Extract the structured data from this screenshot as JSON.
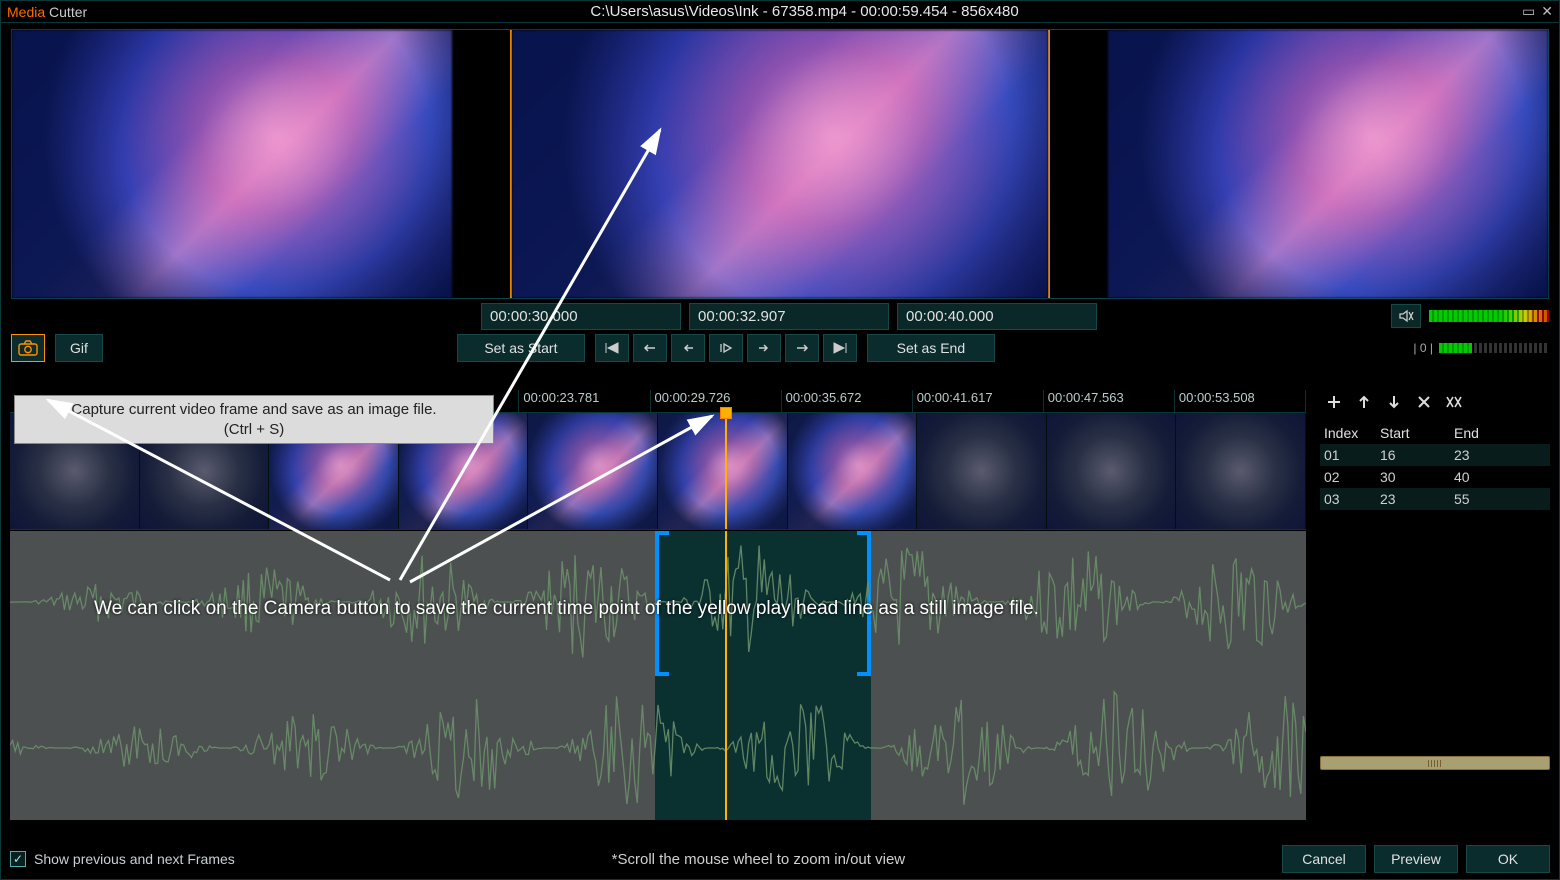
{
  "app": {
    "title_media": "Media",
    "title_cutter": " Cutter"
  },
  "file": {
    "path": "C:\\Users\\asus\\Videos\\Ink - 67358.mp4 - 00:00:59.454 - 856x480"
  },
  "times": {
    "start": "00:00:30.000",
    "current": "00:00:32.907",
    "end": "00:00:40.000"
  },
  "buttons": {
    "gif": "Gif",
    "set_start": "Set as Start",
    "set_end": "Set as End",
    "cancel": "Cancel",
    "preview": "Preview",
    "ok": "OK"
  },
  "tooltip": {
    "line1": "Capture current video frame and save as an image file.",
    "line2": "(Ctrl + S)"
  },
  "ruler": [
    "00:00:23.781",
    "00:00:29.726",
    "00:00:35.672",
    "00:00:41.617",
    "00:00:47.563",
    "00:00:53.508"
  ],
  "segments": {
    "headers": {
      "index": "Index",
      "start": "Start",
      "end": "End"
    },
    "rows": [
      {
        "index": "01",
        "start": "16",
        "end": "23"
      },
      {
        "index": "02",
        "start": "30",
        "end": "40"
      },
      {
        "index": "03",
        "start": "23",
        "end": "55"
      }
    ]
  },
  "volume": {
    "label": "| 0 |"
  },
  "bottom": {
    "checkbox_label": "Show previous and next Frames",
    "hint": "*Scroll the mouse wheel to zoom in/out view"
  },
  "annotation": "We can click on the Camera button to save the current time point of the yellow play head line as a still image file.",
  "playhead_pct": 55.2,
  "selection": {
    "left_pct": 49.8,
    "right_pct": 66.4
  }
}
